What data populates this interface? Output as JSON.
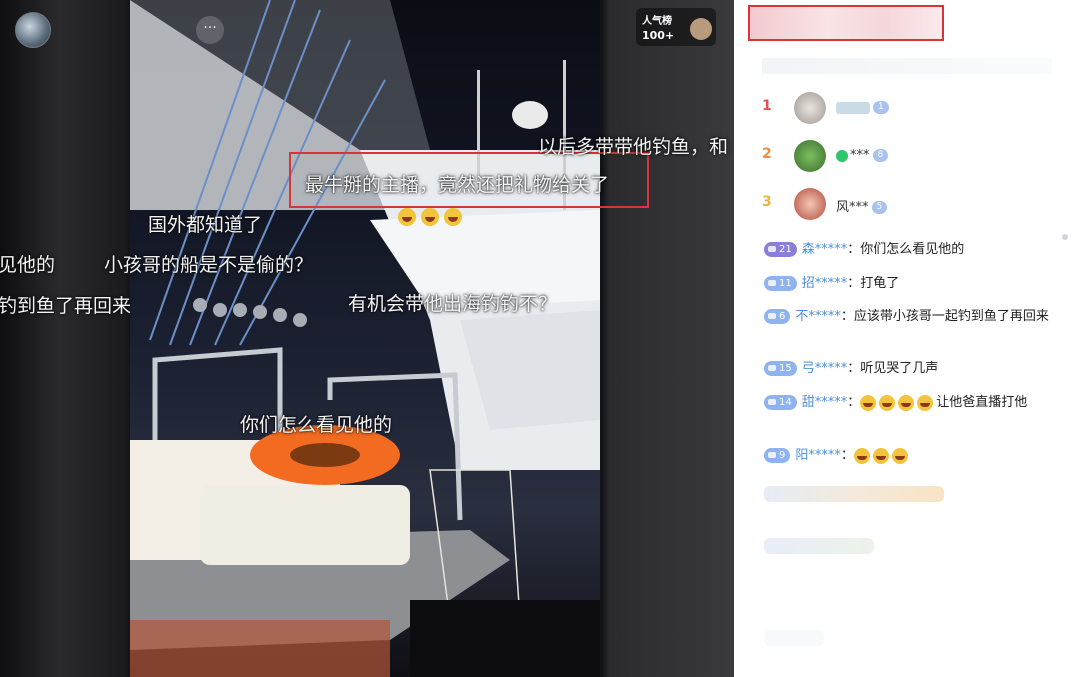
{
  "stream": {
    "more_label": "···",
    "popularity": {
      "label": "人气榜",
      "count": "100+"
    },
    "highlighted_danmu": "最牛掰的主播，竟然还把礼物给关了",
    "danmu": [
      "以后多带带他钓鱼，和",
      "国外都知道了",
      "见他的",
      "小孩哥的船是不是偷的？",
      "钓到鱼了再回来",
      "有机会带他出海钓钓不？",
      "你们怎么看见他的"
    ]
  },
  "ranking": [
    {
      "rank": "1",
      "name": "",
      "level": "1",
      "rank_color": "#e0524f"
    },
    {
      "rank": "2",
      "name": "***",
      "level": "8",
      "rank_color": "#f08a3c"
    },
    {
      "rank": "3",
      "name": "风***",
      "level": "5",
      "rank_color": "#e8b53a"
    }
  ],
  "comments": [
    {
      "level": "21",
      "user": "森*****",
      "sep": "：",
      "text": "你们怎么看见他的"
    },
    {
      "level": "11",
      "user": "招*****",
      "sep": "：",
      "text": "打龟了"
    },
    {
      "level": "6",
      "user": "不*****",
      "sep": "：",
      "text": "应该带小孩哥一起钓到鱼了再回来"
    },
    {
      "level": "15",
      "user": "弓*****",
      "sep": "：",
      "text": "听见哭了几声"
    },
    {
      "level": "14",
      "user": "甜*****",
      "sep": "：",
      "text": "让他爸直播打他"
    },
    {
      "level": "9",
      "user": "阳*****",
      "sep": "：",
      "text": ""
    }
  ],
  "colors": {
    "highlight_border": "#d8343a",
    "username": "#4a8fe0",
    "level_badge": "#8fb3ee"
  }
}
